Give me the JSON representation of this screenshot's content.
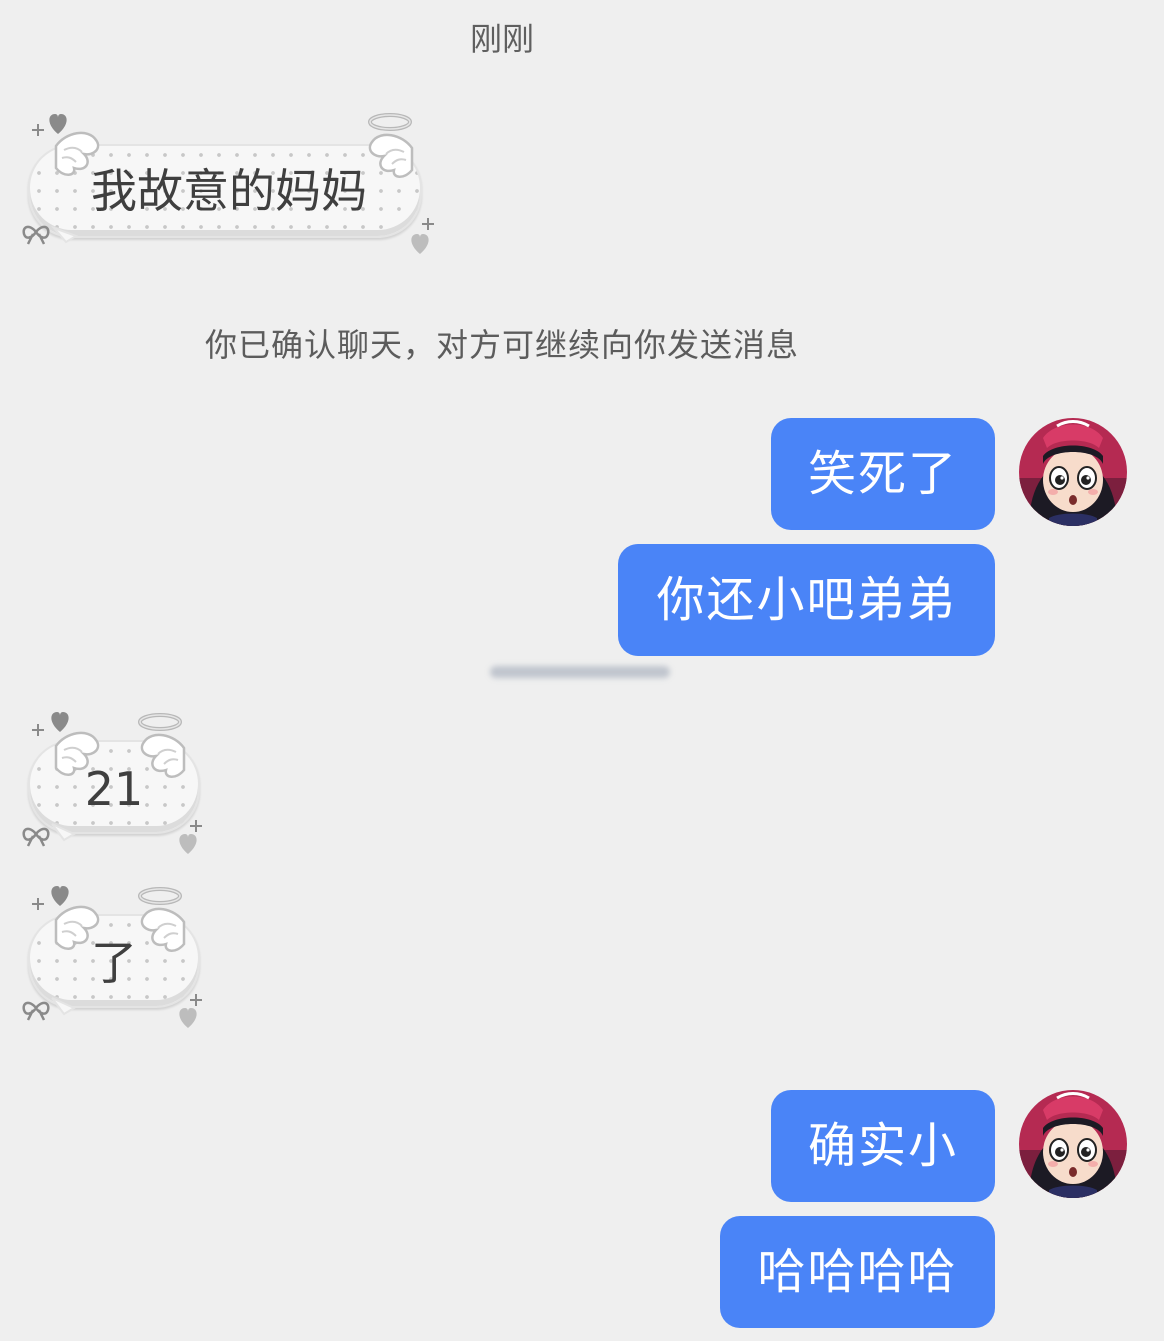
{
  "timestamp": "刚刚",
  "system_note": "你已确认聊天，对方可继续向你发送消息",
  "messages": [
    {
      "side": "incoming",
      "style": "angel-bubble",
      "text": "我故意的妈妈"
    },
    {
      "side": "outgoing",
      "text": "笑死了"
    },
    {
      "side": "outgoing",
      "text": "你还小吧弟弟"
    },
    {
      "side": "incoming",
      "style": "angel-bubble",
      "text": "21"
    },
    {
      "side": "incoming",
      "style": "angel-bubble",
      "text": "了"
    },
    {
      "side": "outgoing",
      "text": "确实小"
    },
    {
      "side": "outgoing",
      "text": "哈哈哈哈"
    }
  ],
  "colors": {
    "background": "#efefef",
    "outgoing_bubble": "#4a84f7",
    "outgoing_text": "#ffffff",
    "incoming_text": "#3f3f3f"
  },
  "icons": {
    "avatar": "anime-girl-avatar",
    "bubble_deco": [
      "angel-wing-icon",
      "halo-icon",
      "heart-icon",
      "sparkle-icon",
      "bow-icon"
    ]
  }
}
